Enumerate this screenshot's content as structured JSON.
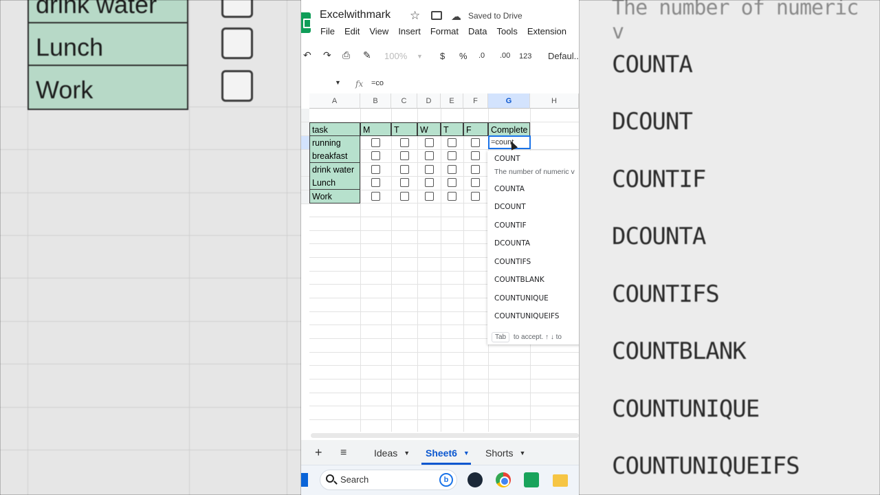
{
  "app": {
    "title": "Excelwithmark",
    "save_status": "Saved to Drive",
    "menu": [
      "File",
      "Edit",
      "View",
      "Insert",
      "Format",
      "Data",
      "Tools",
      "Extension"
    ]
  },
  "toolbar": {
    "zoom": "100%",
    "currency": "$",
    "percent": "%",
    "decrease_decimal": ".0",
    "increase_decimal": ".00",
    "number_format": "123",
    "font": "Defaul..."
  },
  "formula_bar": {
    "fx": "fx",
    "value": "=co"
  },
  "grid": {
    "columns": [
      "A",
      "B",
      "C",
      "D",
      "E",
      "F",
      "G",
      "H"
    ],
    "selected_column": "G",
    "header_row": [
      "task",
      "M",
      "T",
      "W",
      "T",
      "F",
      "Complete"
    ],
    "tasks": [
      "running",
      "breakfast",
      "drink water",
      "Lunch",
      "Work"
    ],
    "active_cell_input": "=count"
  },
  "autocomplete": {
    "items": [
      "COUNT",
      "COUNTA",
      "DCOUNT",
      "COUNTIF",
      "DCOUNTA",
      "COUNTIFS",
      "COUNTBLANK",
      "COUNTUNIQUE",
      "COUNTUNIQUEIFS"
    ],
    "first_description": "The number of numeric v",
    "hint_key": "Tab",
    "hint_text": "to accept.",
    "hint_nav": "↑ ↓ to"
  },
  "sheets": {
    "tabs": [
      "Ideas",
      "Sheet6",
      "Shorts"
    ],
    "active": "Sheet6"
  },
  "taskbar": {
    "search_placeholder": "Search"
  },
  "background_zoom": {
    "left_cells": [
      "drink water",
      "Lunch",
      "Work"
    ],
    "right_description": "The number of numeric v",
    "right_items": [
      "COUNTA",
      "DCOUNT",
      "COUNTIF",
      "DCOUNTA",
      "COUNTIFS",
      "COUNTBLANK",
      "COUNTUNIQUE",
      "COUNTUNIQUEIFS"
    ]
  },
  "colors": {
    "header_green": "#b7e1cd",
    "accent_blue": "#1a73e8",
    "sheets_green": "#0f9d58"
  }
}
